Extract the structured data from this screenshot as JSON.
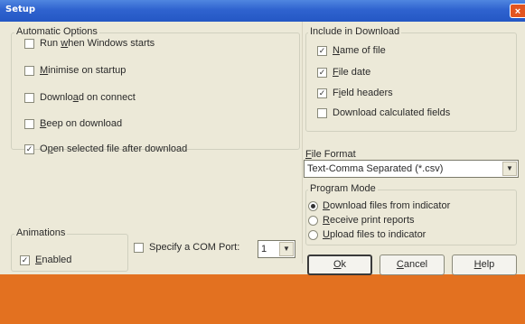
{
  "window": {
    "title": "Setup",
    "close_glyph": "×"
  },
  "automatic_options": {
    "label": "Automatic Options",
    "items": [
      {
        "pre": "Run ",
        "u": "w",
        "post": "hen Windows starts",
        "checked": false
      },
      {
        "pre": "",
        "u": "M",
        "post": "inimise on startup",
        "checked": false
      },
      {
        "pre": "Downlo",
        "u": "a",
        "post": "d on connect",
        "checked": false
      },
      {
        "pre": "",
        "u": "B",
        "post": "eep on download",
        "checked": false
      },
      {
        "pre": "O",
        "u": "p",
        "post": "en selected file after download",
        "checked": true
      }
    ]
  },
  "animations": {
    "label": "Animations",
    "enabled_u": "E",
    "enabled_post": "nabled",
    "enabled_checked": true
  },
  "com_port": {
    "label": "Specify a COM Port",
    "colon": ":",
    "checked": false,
    "value": "1"
  },
  "include_in_download": {
    "label": "Include in Download",
    "items": [
      {
        "pre": "",
        "u": "N",
        "post": "ame of file",
        "checked": true
      },
      {
        "pre": "",
        "u": "F",
        "post": "ile date",
        "checked": true
      },
      {
        "pre": "F",
        "u": "i",
        "post": "eld headers",
        "checked": true
      },
      {
        "pre": "Download calculated fields",
        "u": "",
        "post": "",
        "checked": false
      }
    ]
  },
  "file_format": {
    "label_u": "F",
    "label_post": "ile Format",
    "value": "Text-Comma Separated (*.csv)"
  },
  "program_mode": {
    "label": "Program Mode",
    "options": [
      {
        "u": "D",
        "post": "ownload files from indicator",
        "selected": true
      },
      {
        "u": "R",
        "post": "eceive print reports",
        "selected": false
      },
      {
        "u": "U",
        "post": "pload files to indicator",
        "selected": false
      }
    ]
  },
  "buttons": {
    "ok": {
      "u": "O",
      "post": "k"
    },
    "cancel": {
      "u": "C",
      "post": "ancel"
    },
    "help": {
      "u": "H",
      "post": "elp"
    }
  },
  "colors": {
    "title_bar": "#2f63cf",
    "dialog_bg": "#ece9d8",
    "close_button": "#e2541f",
    "bottom_band": "#e37120"
  },
  "icons": {
    "checkbox_mark": "✓",
    "dropdown": "▼"
  }
}
